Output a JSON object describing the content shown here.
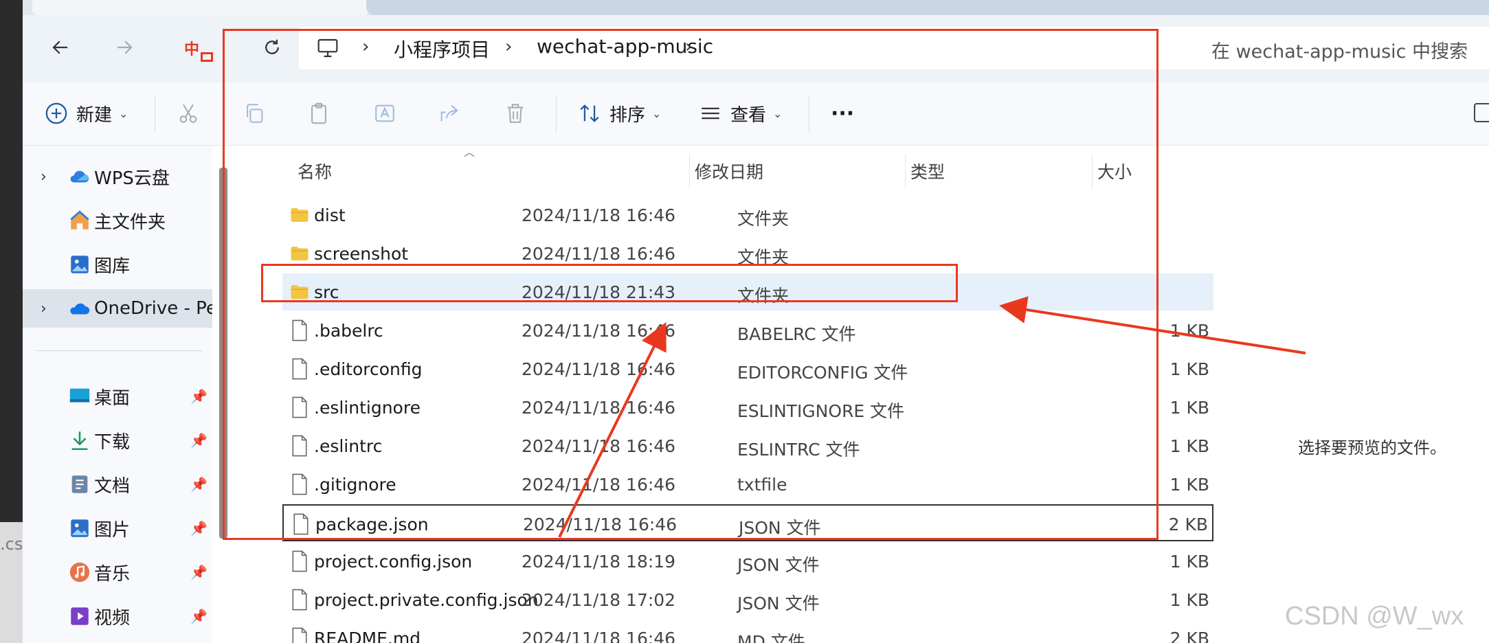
{
  "breadcrumb": {
    "items": [
      "小程序项目",
      "wechat-app-music"
    ]
  },
  "search": {
    "placeholder": "在 wechat-app-music 中搜索"
  },
  "toolbar": {
    "new_label": "新建",
    "sort_label": "排序",
    "view_label": "查看",
    "more_label": "···"
  },
  "sidebar": {
    "items": [
      {
        "label": "WPS云盘",
        "icon": "wps-cloud-icon"
      },
      {
        "label": "主文件夹",
        "icon": "home-icon"
      },
      {
        "label": "图库",
        "icon": "gallery-icon"
      },
      {
        "label": "OneDrive - Per",
        "icon": "onedrive-icon"
      },
      {
        "label": "桌面",
        "icon": "desktop-icon"
      },
      {
        "label": "下载",
        "icon": "download-icon"
      },
      {
        "label": "文档",
        "icon": "documents-icon"
      },
      {
        "label": "图片",
        "icon": "pictures-icon"
      },
      {
        "label": "音乐",
        "icon": "music-icon"
      },
      {
        "label": "视频",
        "icon": "videos-icon"
      }
    ]
  },
  "columns": {
    "name": "名称",
    "date": "修改日期",
    "type": "类型",
    "size": "大小"
  },
  "files": [
    {
      "name": "dist",
      "date": "2024/11/18 16:46",
      "type": "文件夹",
      "size": "",
      "kind": "folder"
    },
    {
      "name": "screenshot",
      "date": "2024/11/18 16:46",
      "type": "文件夹",
      "size": "",
      "kind": "folder"
    },
    {
      "name": "src",
      "date": "2024/11/18 21:43",
      "type": "文件夹",
      "size": "",
      "kind": "folder"
    },
    {
      "name": ".babelrc",
      "date": "2024/11/18 16:46",
      "type": "BABELRC 文件",
      "size": "1 KB",
      "kind": "file"
    },
    {
      "name": ".editorconfig",
      "date": "2024/11/18 16:46",
      "type": "EDITORCONFIG 文件",
      "size": "1 KB",
      "kind": "file"
    },
    {
      "name": ".eslintignore",
      "date": "2024/11/18 16:46",
      "type": "ESLINTIGNORE 文件",
      "size": "1 KB",
      "kind": "file"
    },
    {
      "name": ".eslintrc",
      "date": "2024/11/18 16:46",
      "type": "ESLINTRC 文件",
      "size": "1 KB",
      "kind": "file"
    },
    {
      "name": ".gitignore",
      "date": "2024/11/18 16:46",
      "type": "txtfile",
      "size": "1 KB",
      "kind": "file"
    },
    {
      "name": "package.json",
      "date": "2024/11/18 16:46",
      "type": "JSON 文件",
      "size": "2 KB",
      "kind": "file"
    },
    {
      "name": "project.config.json",
      "date": "2024/11/18 18:19",
      "type": "JSON 文件",
      "size": "1 KB",
      "kind": "file"
    },
    {
      "name": "project.private.config.json",
      "date": "2024/11/18 17:02",
      "type": "JSON 文件",
      "size": "1 KB",
      "kind": "file"
    },
    {
      "name": "README.md",
      "date": "2024/11/18 16:46",
      "type": "MD 文件",
      "size": "2 KB",
      "kind": "file"
    }
  ],
  "preview": {
    "message": "选择要预览的文件。"
  },
  "watermark": "CSDN @W_wx",
  "background_window_text": ".cs",
  "annotation_mark": "中",
  "colors": {
    "annotation": "#e8391f",
    "folder": "#f4c542",
    "selection": "#e5f0fb"
  }
}
